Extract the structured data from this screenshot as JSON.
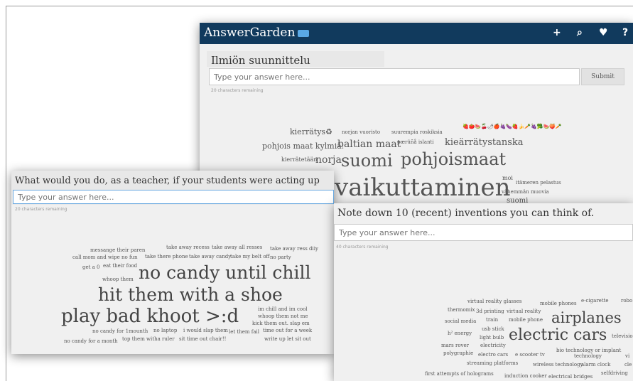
{
  "card1": {
    "brand": "AnswerGarden",
    "nav_icons": [
      "plus-icon",
      "search-icon",
      "heart-icon",
      "help-icon"
    ],
    "nav_glyphs": [
      "+",
      "⌕",
      "♥",
      "?"
    ],
    "title": "Ilmiön suunnittelu",
    "placeholder": "Type your answer here...",
    "submit": "Submit",
    "remaining": "20 characters remaining",
    "words": [
      "kierrätys♻",
      "norjan vuoristo",
      "suurempia roskiksia",
      "🍓🍅🍉🍒🌶🍎🍇🍆🍓🍌🥕🍇🥦🍉🍑🥕",
      "pohjois maat kylmiä.",
      "baltian maat",
      "pærüñå islanti",
      "kieärrätystanska",
      "kierrätetään",
      "norja",
      "suomi",
      "pohjoismaat",
      "vaikuttaminen",
      "moi",
      "itämeren pelastus",
      "vähemmän muovia",
      "suomi"
    ]
  },
  "card2": {
    "title": "What would you do, as a teacher, if your students were acting up",
    "placeholder": "Type your answer here...",
    "remaining": "20 characters remaining",
    "words": [
      "take away recess",
      "take away all resses",
      "take away ress diiy",
      "messange their paren",
      "call mom and wipe",
      "no fun",
      "take there phone",
      "take away candy",
      "take my belt off",
      "no party",
      "get a 0",
      "eat their food",
      "whoop them",
      "no candy until chill",
      "hit them with a shoe",
      "play bad khoot >:d",
      "im chill and im cool",
      "whoop them not me",
      "kick them out. slap em",
      "no candy for 1mounth",
      "no laptop",
      "i would slap them",
      "let them fail",
      "time out for a week",
      "no candy for a month",
      "top them witha ruler",
      "sit time out chair!!",
      "write up let sit out"
    ]
  },
  "card3": {
    "title": "Note down 10 (recent) inventions you can think of.",
    "placeholder": "Type your answer here...",
    "remaining": "40 characters remaining",
    "words": [
      "virtual reality glasses",
      "mobile phones",
      "e-cigarette",
      "robo",
      "thermomix",
      "3d printing",
      "virtual reality",
      "social media",
      "train",
      "mobile phone",
      "airplanes",
      "usb stick",
      "h² energy",
      "light bulb",
      "electric cars",
      "televisio",
      "mars rover",
      "electricity",
      "polygraphie",
      "electro cars",
      "e scooter",
      "tv",
      "bio technology or implant",
      "technology",
      "vi",
      "alarm clock",
      "cle",
      "streaming platforms",
      "wireless technology",
      "selfdriving",
      "first attempts of holograms",
      "induction cooker",
      "electrical bridges"
    ]
  }
}
